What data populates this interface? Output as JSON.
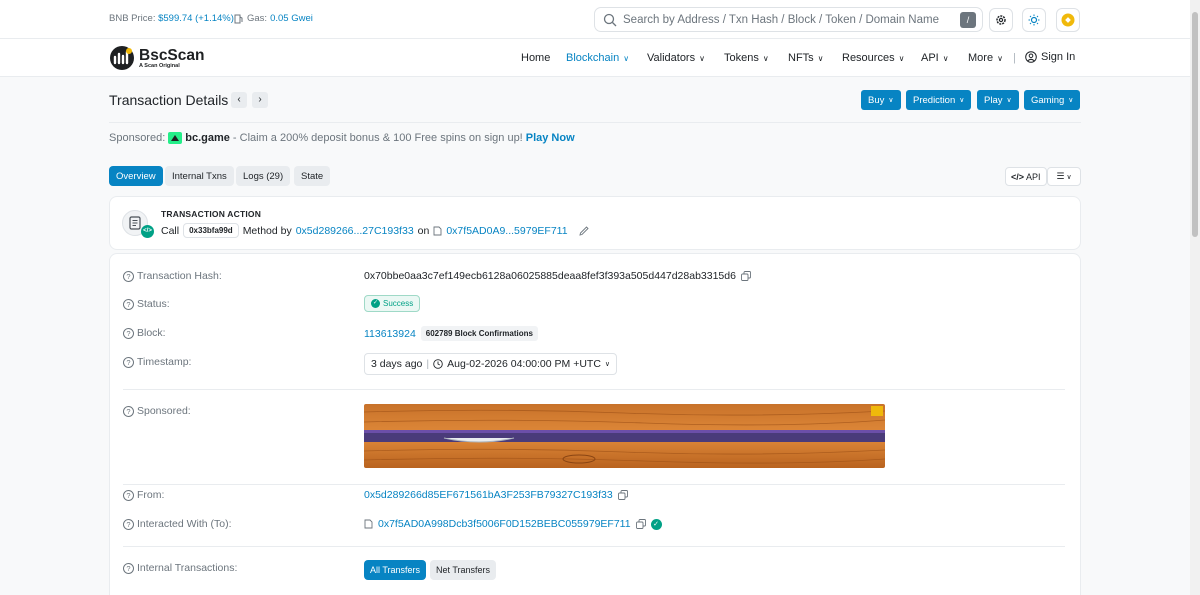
{
  "topbar": {
    "price_label": "BNB Price:",
    "price_value": "$599.74",
    "price_change": "(+1.14%)",
    "gas_label": "Gas:",
    "gas_value": "0.05 Gwei",
    "search_placeholder": "Search by Address / Txn Hash / Block / Token / Domain Name",
    "search_shortcut": "/",
    "icons": [
      "settings-icon",
      "theme-icon",
      "bnb-icon"
    ]
  },
  "header": {
    "logo_name": "BscScan",
    "logo_tagline": "A Scan Original",
    "nav": [
      {
        "label": "Home",
        "has_dropdown": false,
        "active": false
      },
      {
        "label": "Blockchain",
        "has_dropdown": true,
        "active": true
      },
      {
        "label": "Validators",
        "has_dropdown": true,
        "active": false
      },
      {
        "label": "Tokens",
        "has_dropdown": true,
        "active": false
      },
      {
        "label": "NFTs",
        "has_dropdown": true,
        "active": false
      },
      {
        "label": "Resources",
        "has_dropdown": true,
        "active": false
      },
      {
        "label": "API",
        "has_dropdown": true,
        "active": false
      },
      {
        "label": "More",
        "has_dropdown": true,
        "active": false
      }
    ],
    "sign_in": "Sign In"
  },
  "page": {
    "title": "Transaction Details",
    "promo_buttons": [
      "Buy",
      "Prediction",
      "Play",
      "Gaming"
    ]
  },
  "sponsor": {
    "label": "Sponsored:",
    "brand": "bc.game",
    "text": "- Claim a 200% deposit bonus & 100 Free spins on sign up!",
    "cta": "Play Now"
  },
  "tabs": [
    {
      "label": "Overview",
      "active": true
    },
    {
      "label": "Internal Txns",
      "active": false
    },
    {
      "label": "Logs (29)",
      "active": false
    },
    {
      "label": "State",
      "active": false
    }
  ],
  "tools": {
    "api_label": "API"
  },
  "action": {
    "title": "TRANSACTION ACTION",
    "call_label": "Call",
    "method_id": "0x33bfa99d",
    "method_text": "Method by",
    "from": "0x5d289266...27C193f33",
    "on_text": "on",
    "contract": "0x7f5AD0A9...5979EF711"
  },
  "details": {
    "hash_label": "Transaction Hash:",
    "hash_value": "0x70bbe0aa3c7ef149ecb6128a06025885deaa8fef3f393a505d447d28ab3315d6",
    "status_label": "Status:",
    "status_value": "Success",
    "block_label": "Block:",
    "block_value": "113613924",
    "block_confirmations": "602789 Block Confirmations",
    "timestamp_label": "Timestamp:",
    "timestamp_ago": "3 days ago",
    "timestamp_value": "Aug-02-2026 04:00:00 PM +UTC",
    "sponsored_label": "Sponsored:",
    "from_label": "From:",
    "from_value": "0x5d289266d85EF671561bA3F253FB79327C193f33",
    "to_label": "Interacted With (To):",
    "to_value": "0x7f5AD0A998Dcb3f5006F0D152BEBC055979EF711",
    "internal_label": "Internal Transactions:",
    "internal_tabs": [
      "All Transfers",
      "Net Transfers"
    ]
  },
  "colors": {
    "accent": "#0784c3",
    "success": "#00a186",
    "background": "#f8f9fa"
  }
}
